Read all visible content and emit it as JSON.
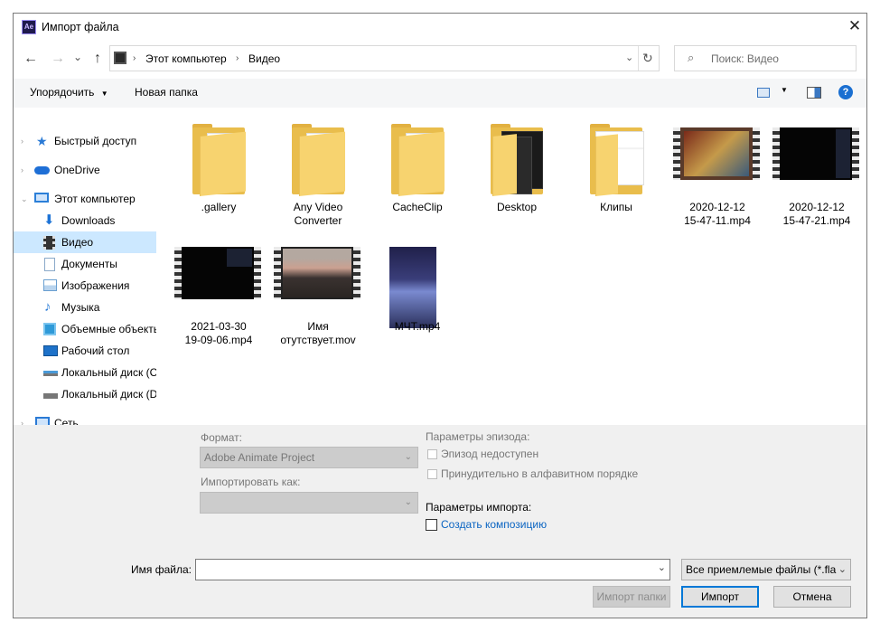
{
  "window": {
    "title": "Импорт файла",
    "app_icon_label": "Ae",
    "close_icon": "close-icon"
  },
  "nav": {
    "back_icon": "←",
    "forward_icon": "→",
    "history_icon": "⌄",
    "up_icon": "↑",
    "breadcrumb": [
      "Этот компьютер",
      "Видео"
    ],
    "refresh_icon": "↻",
    "search_placeholder": "Поиск: Видео"
  },
  "toolbar": {
    "organize": "Упорядочить",
    "new_folder": "Новая папка",
    "help": "?"
  },
  "sidebar": {
    "items": [
      {
        "label": "Быстрый доступ",
        "icon": "star-icon",
        "color": "#2a7ad5"
      },
      {
        "label": "OneDrive",
        "icon": "cloud-icon",
        "color": "#1e6fd6"
      },
      {
        "label": "Этот компьютер",
        "icon": "computer-icon",
        "color": "#2b7fd8"
      },
      {
        "label": "Downloads",
        "icon": "download-icon",
        "color": "#1d73d6"
      },
      {
        "label": "Видео",
        "icon": "video-icon",
        "color": "#333333"
      },
      {
        "label": "Документы",
        "icon": "document-icon",
        "color": "#8aa9c9"
      },
      {
        "label": "Изображения",
        "icon": "image-icon",
        "color": "#6a9fd0"
      },
      {
        "label": "Музыка",
        "icon": "music-icon",
        "color": "#2d7ed8"
      },
      {
        "label": "Объемные объекты",
        "icon": "cube-icon",
        "color": "#2f9ad8"
      },
      {
        "label": "Рабочий стол",
        "icon": "desktop-icon",
        "color": "#1e72c9"
      },
      {
        "label": "Локальный диск (C",
        "icon": "drive-icon",
        "color": "#555555"
      },
      {
        "label": "Локальный диск (D",
        "icon": "drive-icon",
        "color": "#555555"
      },
      {
        "label": "Сеть",
        "icon": "network-icon",
        "color": "#2a7ad5"
      }
    ]
  },
  "files": [
    {
      "name": ".gallery",
      "kind": "folder"
    },
    {
      "name": "Any Video\nConverter",
      "kind": "folder"
    },
    {
      "name": "CacheClip",
      "kind": "folder"
    },
    {
      "name": "Desktop",
      "kind": "folder-dark"
    },
    {
      "name": "Клипы",
      "kind": "folder"
    },
    {
      "name": "2020-12-12\n15-47-11.mp4",
      "kind": "video"
    },
    {
      "name": "2020-12-12\n15-47-21.mp4",
      "kind": "video"
    },
    {
      "name": "2021-03-30\n19-09-06.mp4",
      "kind": "video"
    },
    {
      "name": "Имя\nотутствует.mov",
      "kind": "video"
    },
    {
      "name": "МЧТ.mp4",
      "kind": "portrait"
    }
  ],
  "options": {
    "format_label": "Формат:",
    "format_value": "Adobe Animate Project",
    "import_as_label": "Импортировать как:",
    "import_as_value": "",
    "episode_params_label": "Параметры эпизода:",
    "episode_unavailable": "Эпизод недоступен",
    "alphabetical": "Принудительно в алфавитном порядке",
    "import_params_label": "Параметры импорта:",
    "create_composition": "Создать композицию"
  },
  "footer": {
    "filename_label": "Имя файла:",
    "filename_value": "",
    "filetype_value": "Все приемлемые файлы (*.fla",
    "import_folder_button": "Импорт папки",
    "import_button": "Импорт",
    "cancel_button": "Отмена"
  }
}
